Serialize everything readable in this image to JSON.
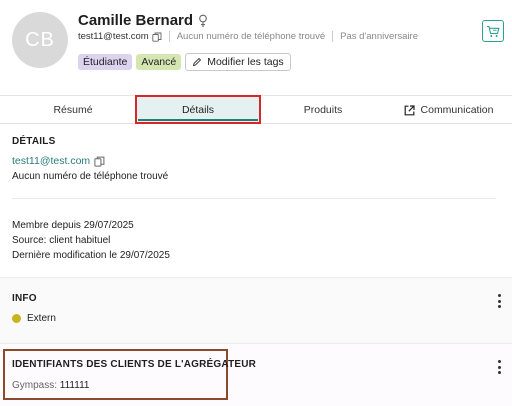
{
  "profile": {
    "initials": "CB",
    "name": "Camille Bernard",
    "email": "test11@test.com",
    "phone_status": "Aucun numéro de téléphone trouvé",
    "birthday_status": "Pas d'anniversaire",
    "tags": [
      "Étudiante",
      "Avancé"
    ],
    "edit_tags_label": "Modifier les tags"
  },
  "tabs": {
    "resume": "Résumé",
    "details": "Détails",
    "products": "Produits",
    "communication": "Communication",
    "active": "details"
  },
  "details": {
    "title": "DÉTAILS",
    "email": "test11@test.com",
    "phone": "Aucun numéro de téléphone trouvé",
    "member_since": "Membre depuis 29/07/2025",
    "source": "Source: client habituel",
    "last_modified": "Dernière modification le 29/07/2025"
  },
  "info": {
    "title": "INFO",
    "status_label": "Extern",
    "status_color": "#c9b41e"
  },
  "aggregator": {
    "title": "IDENTIFIANTS DES CLIENTS DE L'AGRÉGATEUR",
    "entries": [
      {
        "key": "Gympass:",
        "value": "111111"
      }
    ]
  },
  "colors": {
    "accent": "#2b7a78",
    "highlight_red": "#d62828",
    "highlight_brown": "#8a4a2e"
  }
}
